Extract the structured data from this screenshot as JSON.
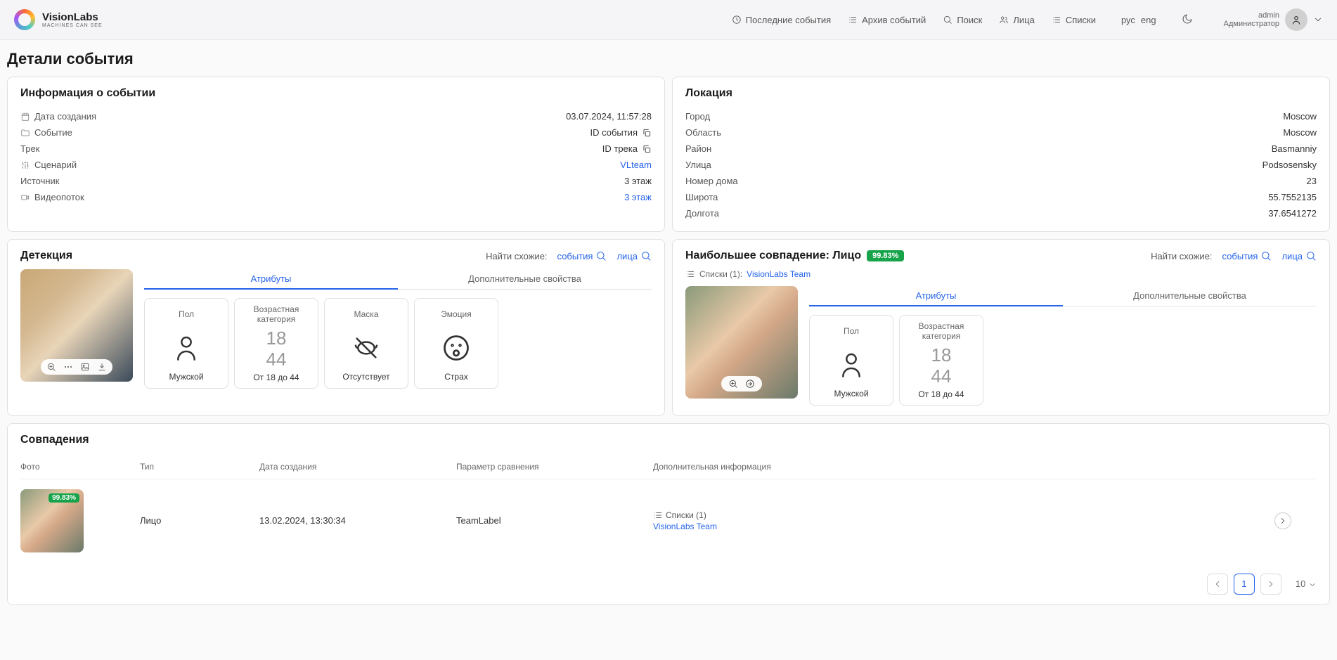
{
  "header": {
    "logo": {
      "title": "VisionLabs",
      "subtitle": "MACHINES CAN SEE"
    },
    "nav": {
      "last_events": "Последние события",
      "archive": "Архив событий",
      "search": "Поиск",
      "faces": "Лица",
      "lists": "Списки"
    },
    "lang": {
      "ru": "рус",
      "en": "eng"
    },
    "user": {
      "name": "admin",
      "role": "Администратор"
    }
  },
  "page_title": "Детали события",
  "event_info": {
    "title": "Информация о событии",
    "rows": {
      "date_label": "Дата создания",
      "date_value": "03.07.2024, 11:57:28",
      "event_label": "Событие",
      "event_value": "ID события",
      "track_label": "Трек",
      "track_value": "ID трека",
      "scenario_label": "Сценарий",
      "scenario_value": "VLteam",
      "source_label": "Источник",
      "source_value": "3 этаж",
      "stream_label": "Видеопоток",
      "stream_value": "3 этаж"
    }
  },
  "location": {
    "title": "Локация",
    "rows": {
      "city_label": "Город",
      "city_value": "Moscow",
      "region_label": "Область",
      "region_value": "Moscow",
      "district_label": "Район",
      "district_value": "Basmanniy",
      "street_label": "Улица",
      "street_value": "Podsosensky",
      "house_label": "Номер дома",
      "house_value": "23",
      "lat_label": "Широта",
      "lat_value": "55.7552135",
      "lon_label": "Долгота",
      "lon_value": "37.6541272"
    }
  },
  "detection": {
    "title": "Детекция",
    "similar_label": "Найти схожие:",
    "similar_events": "события",
    "similar_faces": "лица",
    "tabs": {
      "attributes": "Атрибуты",
      "extra": "Дополнительные свойства"
    },
    "attrs": {
      "gender_title": "Пол",
      "gender_value": "Мужской",
      "age_title": "Возрастная категория",
      "age_min": "18",
      "age_max": "44",
      "age_value": "От 18 до 44",
      "mask_title": "Маска",
      "mask_value": "Отсутствует",
      "emotion_title": "Эмоция",
      "emotion_value": "Страх"
    }
  },
  "top_match": {
    "title_prefix": "Наибольшее совпадение: Лицо",
    "badge": "99.83%",
    "similar_label": "Найти схожие:",
    "similar_events": "события",
    "similar_faces": "лица",
    "lists_label": "Списки (1):",
    "lists_value": "VisionLabs Team",
    "tabs": {
      "attributes": "Атрибуты",
      "extra": "Дополнительные свойства"
    },
    "attrs": {
      "gender_title": "Пол",
      "gender_value": "Мужской",
      "age_title": "Возрастная категория",
      "age_min": "18",
      "age_max": "44",
      "age_value": "От 18 до 44"
    }
  },
  "matches": {
    "title": "Совпадения",
    "columns": {
      "photo": "Фото",
      "type": "Тип",
      "date": "Дата создания",
      "param": "Параметр сравнения",
      "extra": "Дополнительная информация"
    },
    "row": {
      "badge": "99.83%",
      "type": "Лицо",
      "date": "13.02.2024, 13:30:34",
      "param": "TeamLabel",
      "lists_label": "Списки (1)",
      "lists_value": "VisionLabs Team"
    },
    "pagination": {
      "page": "1",
      "per_page": "10"
    }
  }
}
